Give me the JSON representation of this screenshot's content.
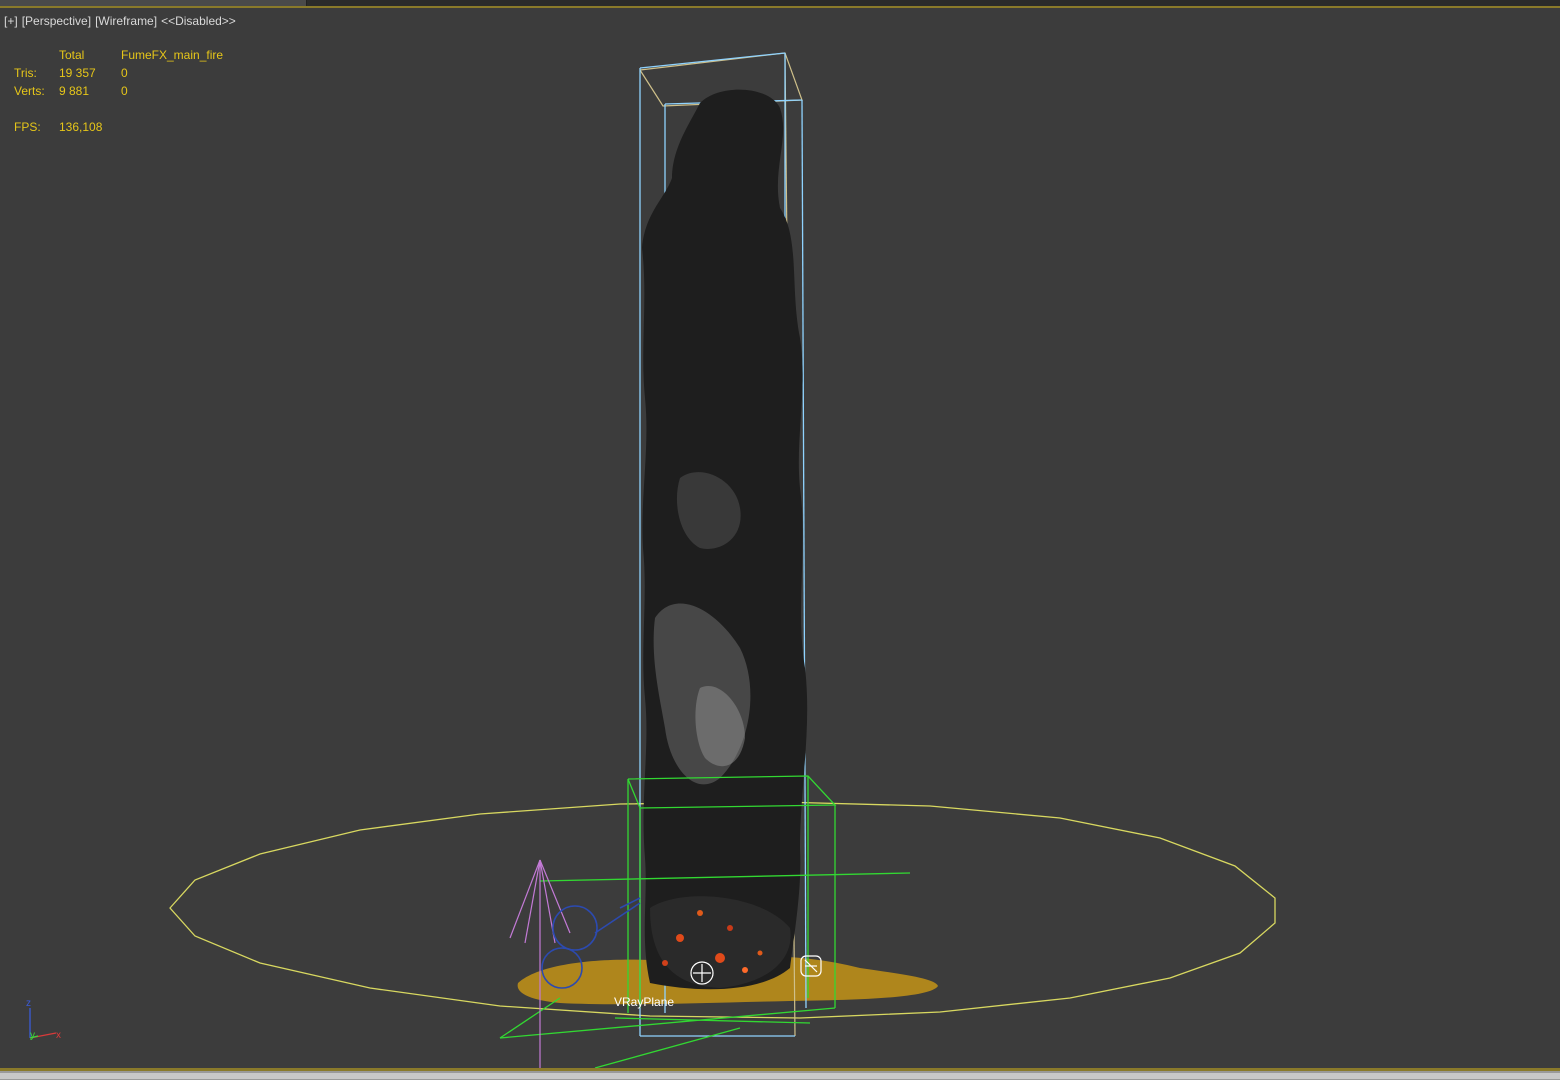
{
  "viewport": {
    "labels": {
      "plus": "[+]",
      "view": "[Perspective]",
      "shading": "[Wireframe]",
      "mode": "<<Disabled>>"
    },
    "stats": {
      "header_total": "Total",
      "header_object": "FumeFX_main_fire",
      "tris_label": "Tris:",
      "tris_total": "19 357",
      "tris_object": "0",
      "verts_label": "Verts:",
      "verts_total": "9 881",
      "verts_object": "0",
      "fps_label": "FPS:",
      "fps_value": "136,108"
    },
    "scene": {
      "plane_label": "VRayPlane",
      "axis": {
        "z": "z",
        "y": "y",
        "x": "x"
      }
    }
  },
  "colors": {
    "viewport_bg": "#3c3c3c",
    "stats_text": "#e6c619",
    "label_text": "#d9d9d9",
    "fume_box": "#8fd3ff",
    "fume_box_outer": "#cfc08a",
    "emitter_box": "#32d832",
    "ground_circle": "#d8d860",
    "plane_fill": "#b58a1a",
    "camera": "#c37ad6"
  }
}
